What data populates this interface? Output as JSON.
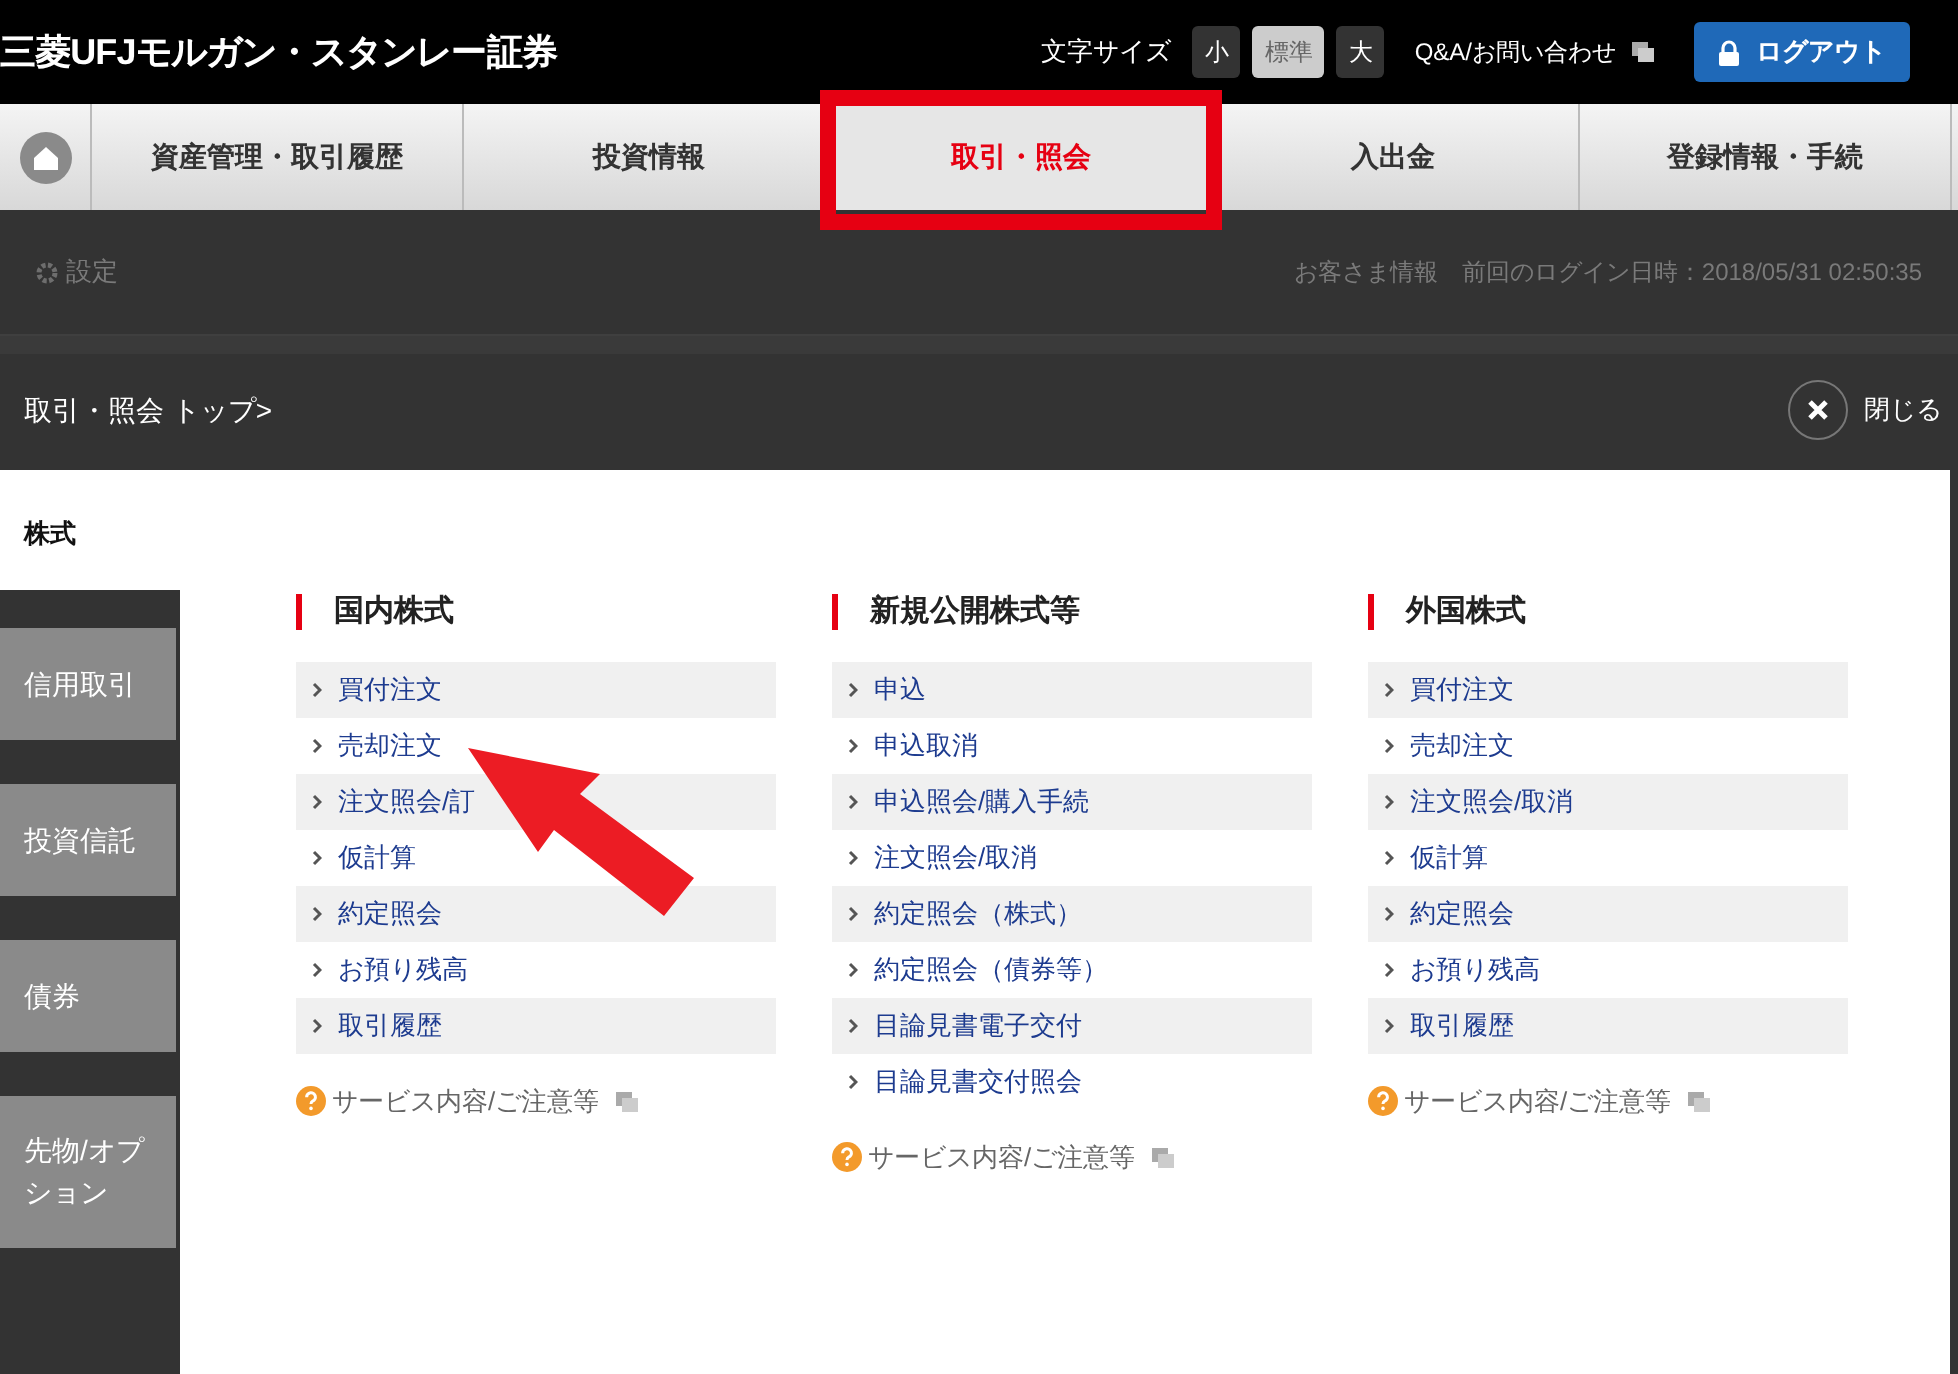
{
  "header": {
    "logo": "三菱UFJモルガン・スタンレー証券",
    "font_size_label": "文字サイズ",
    "font_sizes": [
      {
        "label": "小",
        "selected": false
      },
      {
        "label": "標準",
        "selected": true
      },
      {
        "label": "大",
        "selected": false
      }
    ],
    "help_link": "Q&A/お問い合わせ",
    "logout": "ログアウト"
  },
  "nav": [
    {
      "label": "資産管理・取引履歴",
      "selected": false
    },
    {
      "label": "投資情報",
      "selected": false
    },
    {
      "label": "取引・照会",
      "selected": true
    },
    {
      "label": "入出金",
      "selected": false
    },
    {
      "label": "登録情報・手続",
      "selected": false
    }
  ],
  "subbar": {
    "settings": "設定",
    "customer_info": "お客さま情報",
    "last_login": "前回のログイン日時：2018/05/31 02:50:35"
  },
  "overlay": {
    "breadcrumb": "取引・照会 トップ>",
    "close": "閉じる",
    "section": "株式",
    "side_tabs": [
      "信用取引",
      "投資信託",
      "債券",
      "先物/オプション"
    ],
    "columns": [
      {
        "title": "国内株式",
        "items": [
          "買付注文",
          "売却注文",
          "注文照会/訂",
          "仮計算",
          "約定照会",
          "お預り残高",
          "取引履歴"
        ],
        "note": "サービス内容/ご注意等"
      },
      {
        "title": "新規公開株式等",
        "items": [
          "申込",
          "申込取消",
          "申込照会/購入手続",
          "注文照会/取消",
          "約定照会（株式）",
          "約定照会（債券等）",
          "目論見書電子交付",
          "目論見書交付照会"
        ],
        "note": "サービス内容/ご注意等"
      },
      {
        "title": "外国株式",
        "items": [
          "買付注文",
          "売却注文",
          "注文照会/取消",
          "仮計算",
          "約定照会",
          "お預り残高",
          "取引履歴"
        ],
        "note": "サービス内容/ご注意等"
      }
    ]
  }
}
